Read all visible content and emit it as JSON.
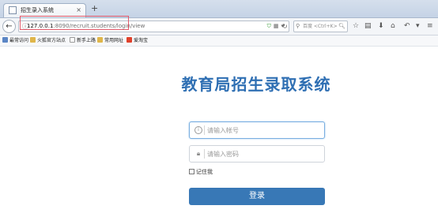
{
  "browser": {
    "tab": {
      "title": "招生录入系统",
      "close": "×",
      "favicon": "page-icon"
    },
    "new_tab": "+",
    "nav": {
      "back": "←",
      "url_host": "127.0.0.1",
      "url_path": ":8090/recruit.students/login/view",
      "search_placeholder": "百度 <Ctrl+K>",
      "icons": [
        "lock-icon",
        "shield-icon",
        "qr-icon",
        "dropdown-icon",
        "reload-icon",
        "search-icon",
        "star-icon",
        "reading-list-icon",
        "download-icon",
        "home-icon",
        "undo-icon",
        "menu-icon"
      ]
    },
    "bookmarks": [
      {
        "label": "最常访问",
        "icon": "bookmark-icon",
        "color": "#5b86c5"
      },
      {
        "label": "火狐官方站点",
        "icon": "folder-icon",
        "color": "#e0b64a"
      },
      {
        "label": "新手上路",
        "icon": "page-icon",
        "color": "#ffffff"
      },
      {
        "label": "常用网址",
        "icon": "folder-icon",
        "color": "#e0b64a"
      },
      {
        "label": "爱淘宝",
        "icon": "taobao-icon",
        "color": "#e0412b"
      }
    ]
  },
  "page": {
    "title": "教育局招生录取系统",
    "username_placeholder": "请输入帐号",
    "password_placeholder": "请输入密码",
    "remember_label": "记住我",
    "login_button": "登录",
    "colors": {
      "accent": "#3878b6",
      "title": "#2f6fb3",
      "highlight": "#e35a6a"
    }
  }
}
